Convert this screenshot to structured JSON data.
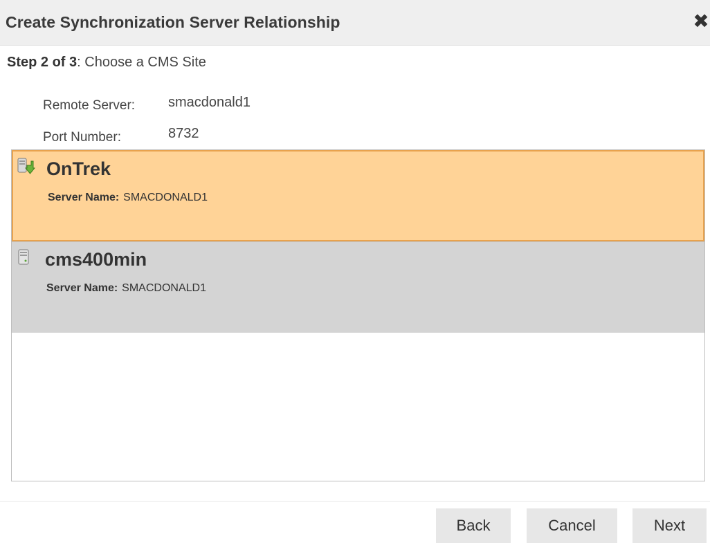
{
  "dialog": {
    "title": "Create Synchronization Server Relationship",
    "close_glyph": "✖"
  },
  "step": {
    "bold": "Step 2 of 3",
    "text": ": Choose a CMS Site"
  },
  "fields": {
    "remote_server_label": "Remote Server:",
    "remote_server_value": "smacdonald1",
    "port_label": "Port Number:",
    "port_value": "8732"
  },
  "sites": [
    {
      "name": "OnTrek",
      "server_label": "Server Name:",
      "server_value": "SMACDONALD1",
      "selected": true,
      "icon": "server-download-icon"
    },
    {
      "name": "cms400min",
      "server_label": "Server Name:",
      "server_value": "SMACDONALD1",
      "selected": false,
      "icon": "server-icon"
    }
  ],
  "buttons": {
    "back": "Back",
    "cancel": "Cancel",
    "next": "Next"
  },
  "colors": {
    "selected_bg": "#ffd397",
    "selected_border": "#e8a24d",
    "item_bg": "#d4d4d4",
    "button_bg": "#e7e7e7"
  }
}
